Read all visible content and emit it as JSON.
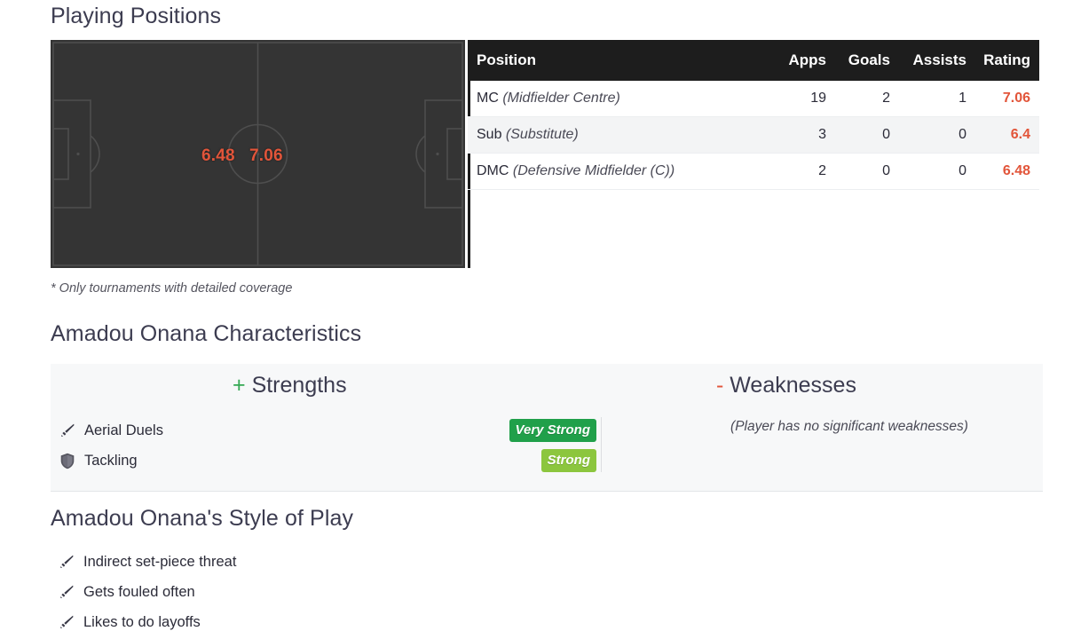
{
  "sections": {
    "playing_positions_title": "Playing Positions",
    "characteristics_title": "Amadou Onana Characteristics",
    "style_title": "Amadou Onana's Style of Play"
  },
  "pitch": {
    "note": "* Only tournaments with detailed coverage",
    "ratings": [
      {
        "label": "6.48",
        "position": "DMC"
      },
      {
        "label": "7.06",
        "position": "MC"
      }
    ],
    "colors": {
      "field": "#343434",
      "lines": "#4f4f4f",
      "rating": "#e2553a"
    }
  },
  "positions_table": {
    "columns": {
      "position": "Position",
      "apps": "Apps",
      "goals": "Goals",
      "assists": "Assists",
      "rating": "Rating"
    },
    "rows": [
      {
        "code": "MC",
        "long": "(Midfielder Centre)",
        "apps": "19",
        "goals": "2",
        "assists": "1",
        "rating": "7.06"
      },
      {
        "code": "Sub",
        "long": "(Substitute)",
        "apps": "3",
        "goals": "0",
        "assists": "0",
        "rating": "6.4"
      },
      {
        "code": "DMC",
        "long": "(Defensive Midfielder (C))",
        "apps": "2",
        "goals": "0",
        "assists": "0",
        "rating": "6.48"
      }
    ]
  },
  "characteristics": {
    "strengths_sign": "+",
    "strengths_label": "Strengths",
    "weaknesses_sign": "-",
    "weaknesses_label": "Weaknesses",
    "strengths": [
      {
        "icon": "sword-icon",
        "label": "Aerial Duels",
        "badge": "Very Strong",
        "badge_color": "#20a04a"
      },
      {
        "icon": "shield-icon",
        "label": "Tackling",
        "badge": "Strong",
        "badge_color": "#8cc63e"
      }
    ],
    "weaknesses_note": "(Player has no significant weaknesses)"
  },
  "style_of_play": {
    "items": [
      {
        "icon": "sword-icon",
        "label": "Indirect set-piece threat"
      },
      {
        "icon": "sword-icon",
        "label": "Gets fouled often"
      },
      {
        "icon": "sword-icon",
        "label": "Likes to do layoffs"
      }
    ]
  }
}
